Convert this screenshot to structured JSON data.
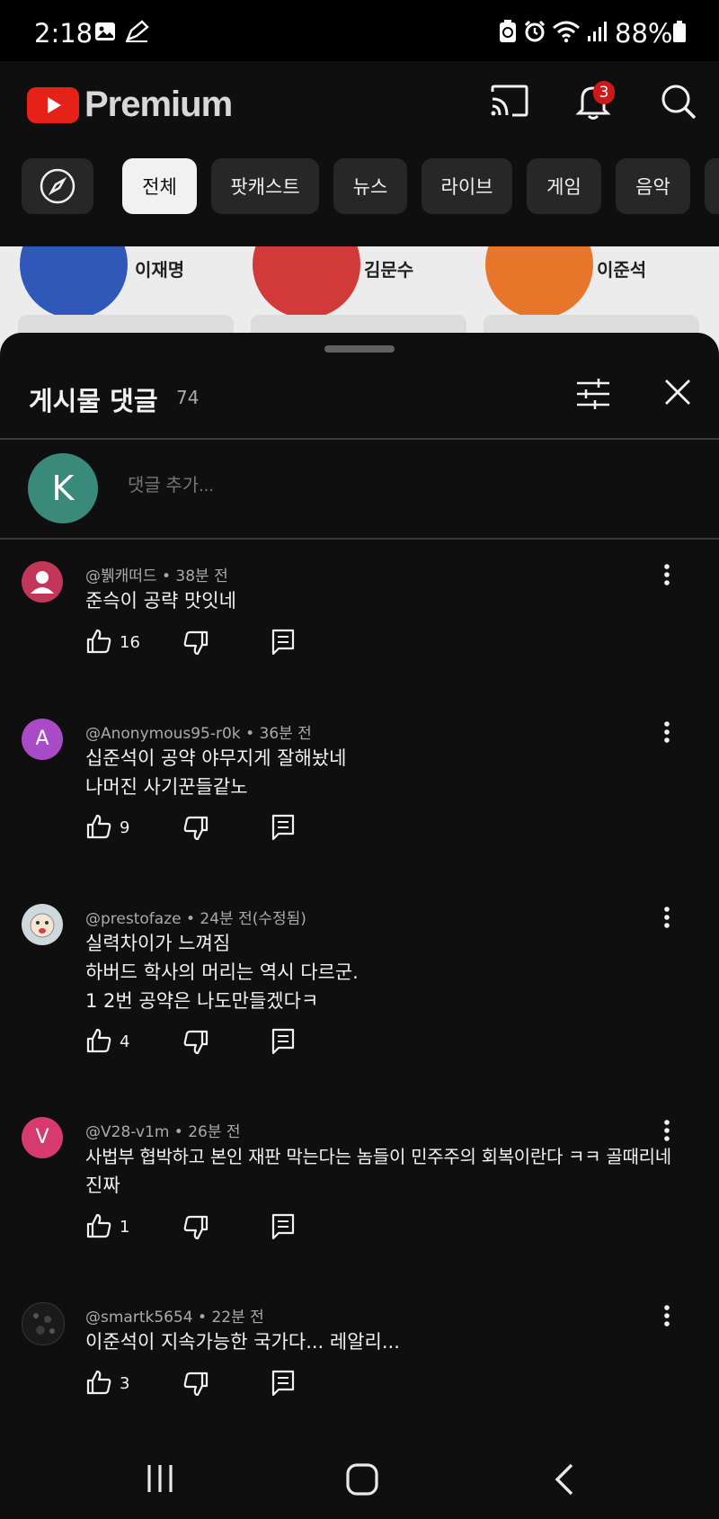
{
  "status_bar": {
    "time": "2:18",
    "battery": "88%"
  },
  "app": {
    "logo_text": "Premium",
    "notification_count": "3"
  },
  "chips": [
    {
      "label": ""
    },
    {
      "label": "전체",
      "active": true
    },
    {
      "label": "팟캐스트"
    },
    {
      "label": "뉴스"
    },
    {
      "label": "라이브"
    },
    {
      "label": "게임"
    },
    {
      "label": "음악"
    }
  ],
  "post_peek": {
    "names": [
      "이재명",
      "김문수",
      "이준석"
    ]
  },
  "comments_sheet": {
    "title": "게시물 댓글",
    "count": "74",
    "my_avatar_letter": "K",
    "add_placeholder": "댓글 추가..."
  },
  "comments": [
    {
      "avatar": "",
      "avatar_color": "#c2365a",
      "author": "@뷁캐떠드",
      "time": "38분 전",
      "lines": [
        "준슥이 공략 맛잇네"
      ],
      "likes": "16"
    },
    {
      "avatar": "A",
      "avatar_color": "#a94ac7",
      "author": "@Anonymous95-r0k",
      "time": "36분 전",
      "lines": [
        "십준석이 공약 야무지게 잘해놨네",
        "나머진 사기꾼들같노"
      ],
      "likes": "9"
    },
    {
      "avatar": "",
      "avatar_color": "#cfd8dc",
      "author": "@prestofaze",
      "time": "24분 전(수정됨)",
      "lines": [
        "실력차이가 느껴짐",
        "하버드 학사의 머리는 역시 다르군.",
        "1 2번 공약은 나도만들겠다ㅋ"
      ],
      "likes": "4"
    },
    {
      "avatar": "V",
      "avatar_color": "#d63a6e",
      "author": "@V28-v1m",
      "time": "26분 전",
      "lines": [
        "사법부 협박하고 본인 재판 막는다는 놈들이 민주주의 회복이란다 ㅋㅋ 골때리네",
        "진짜"
      ],
      "likes": "1"
    },
    {
      "avatar": "",
      "avatar_color": "#1a1a1a",
      "author": "@smartk5654",
      "time": "22분 전",
      "lines": [
        "이준석이 지속가능한 국가다... 레알리..."
      ],
      "likes": "3"
    }
  ]
}
